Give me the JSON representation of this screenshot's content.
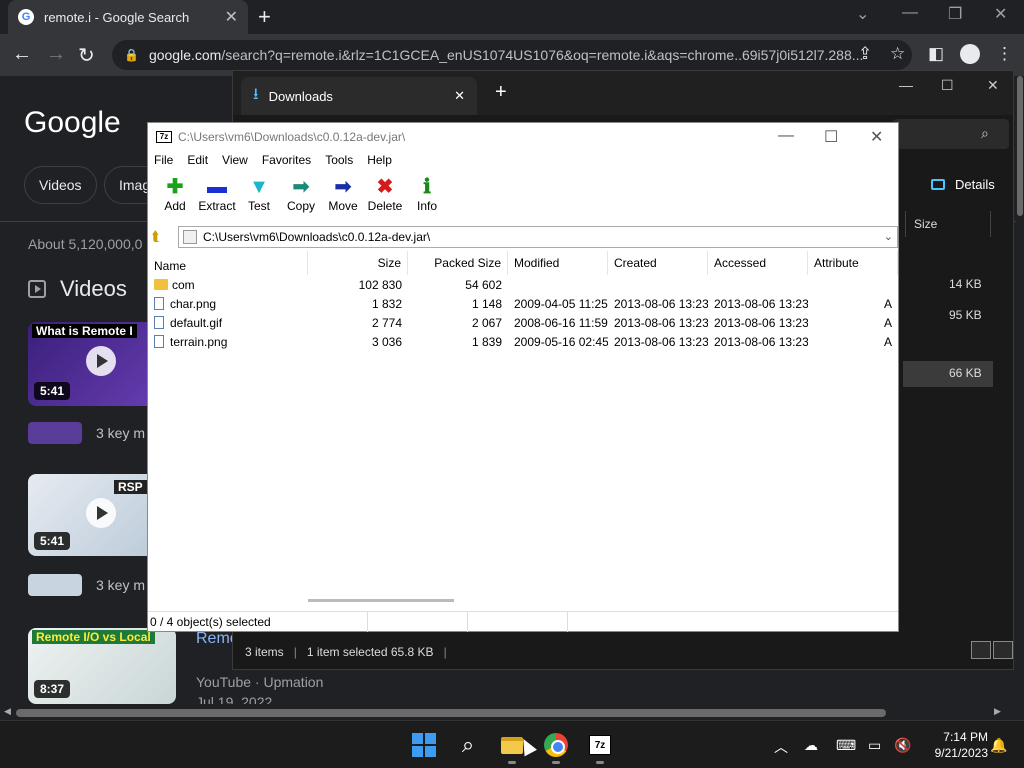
{
  "chrome": {
    "tab_title": "remote.i - Google Search",
    "url_host": "google.com",
    "url_rest": "/search?q=remote.i&rlz=1C1GCEA_enUS1074US1076&oq=remote.i&aqs=chrome..69i57j0i512l7.288..."
  },
  "google": {
    "logo": "Google",
    "chips": [
      "Videos",
      "Imag"
    ],
    "about": "About 5,120,000,0",
    "videos_heading": "Videos",
    "video1": {
      "caption": "What is Remote I",
      "duration": "5:41",
      "key_moments": "3 key m"
    },
    "video2": {
      "caption": "RSP",
      "duration": "5:41",
      "key_moments": "3 key m"
    },
    "video3": {
      "caption": "Remote I/O vs Local",
      "duration": "8:37",
      "link": "Remo",
      "source": "YouTube · Upmation",
      "date": "Jul 19, 2022"
    }
  },
  "downloads": {
    "tab_title": "Downloads",
    "details_label": "Details",
    "col_size": "Size",
    "sizes": [
      "14 KB",
      "95 KB",
      "66 KB"
    ],
    "status_items": "3 items",
    "status_selected": "1 item selected  65.8 KB"
  },
  "sevenzip": {
    "title": "C:\\Users\\vm6\\Downloads\\c0.0.12a-dev.jar\\",
    "logo": "7z",
    "menu": [
      "File",
      "Edit",
      "View",
      "Favorites",
      "Tools",
      "Help"
    ],
    "tools": [
      {
        "label": "Add",
        "icon": "plus-icon",
        "glyph": "✚",
        "color": "#1aa31a"
      },
      {
        "label": "Extract",
        "icon": "minus-icon",
        "glyph": "▬",
        "color": "#1a2fd6"
      },
      {
        "label": "Test",
        "icon": "check-icon",
        "glyph": "▼",
        "color": "#19b5c8"
      },
      {
        "label": "Copy",
        "icon": "copy-arrow-icon",
        "glyph": "➡",
        "color": "#1a8a7a"
      },
      {
        "label": "Move",
        "icon": "move-arrow-icon",
        "glyph": "➡",
        "color": "#1a2fa6"
      },
      {
        "label": "Delete",
        "icon": "delete-x-icon",
        "glyph": "✖",
        "color": "#d41a1a"
      },
      {
        "label": "Info",
        "icon": "info-icon",
        "glyph": "ℹ",
        "color": "#1a8a1a"
      }
    ],
    "address": "C:\\Users\\vm6\\Downloads\\c0.0.12a-dev.jar\\",
    "columns": {
      "name": "Name",
      "size": "Size",
      "packed": "Packed Size",
      "modified": "Modified",
      "created": "Created",
      "accessed": "Accessed",
      "attributes": "Attribute"
    },
    "rows": [
      {
        "name": "com",
        "type": "folder",
        "size": "102 830",
        "packed": "54 602",
        "modified": "",
        "created": "",
        "accessed": "",
        "attr": ""
      },
      {
        "name": "char.png",
        "type": "file",
        "size": "1 832",
        "packed": "1 148",
        "modified": "2009-04-05 11:25",
        "created": "2013-08-06 13:23",
        "accessed": "2013-08-06 13:23",
        "attr": "A"
      },
      {
        "name": "default.gif",
        "type": "file",
        "size": "2 774",
        "packed": "2 067",
        "modified": "2008-06-16 11:59",
        "created": "2013-08-06 13:23",
        "accessed": "2013-08-06 13:23",
        "attr": "A"
      },
      {
        "name": "terrain.png",
        "type": "file",
        "size": "3 036",
        "packed": "1 839",
        "modified": "2009-05-16 02:45",
        "created": "2013-08-06 13:23",
        "accessed": "2013-08-06 13:23",
        "attr": "A"
      }
    ],
    "status": "0 / 4 object(s) selected"
  },
  "taskbar": {
    "sz_label": "7z",
    "time": "7:14 PM",
    "date": "9/21/2023"
  }
}
